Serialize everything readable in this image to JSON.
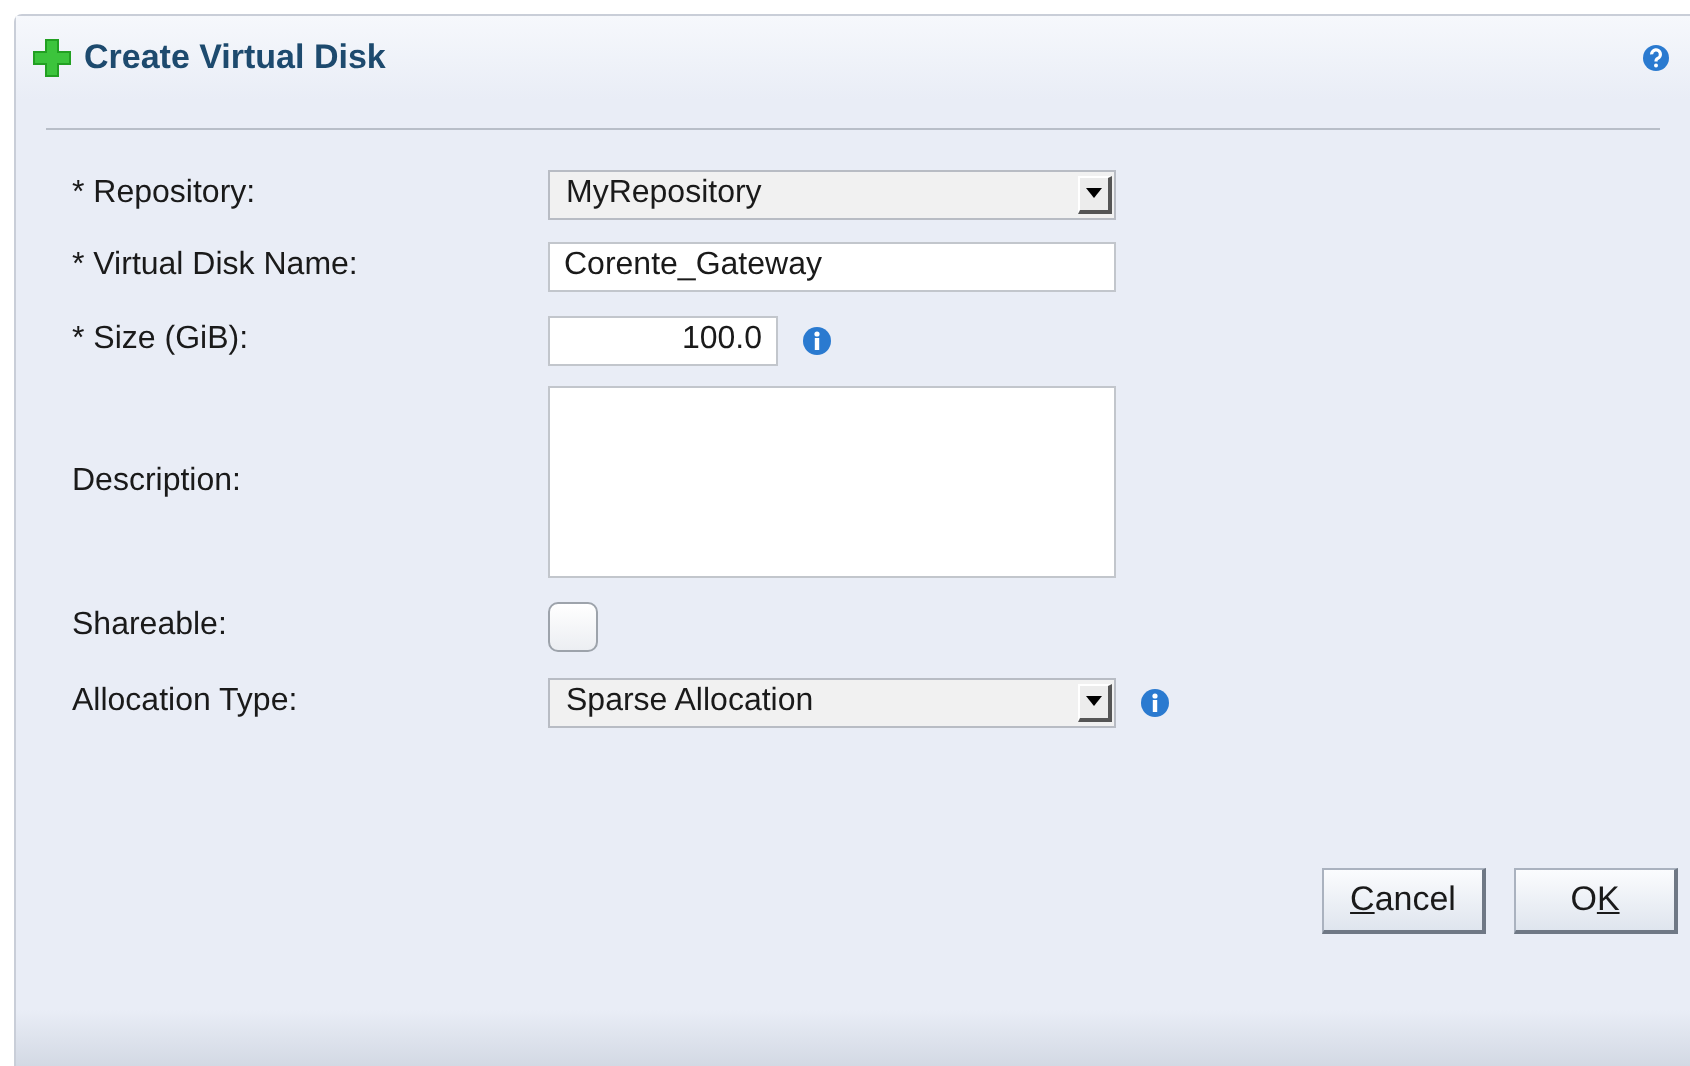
{
  "dialog": {
    "title": "Create Virtual Disk"
  },
  "fields": [
    {
      "kind": "select",
      "label": "* Repository:",
      "value": "MyRepository"
    },
    {
      "kind": "text",
      "label": "* Virtual Disk Name:",
      "value": "Corente_Gateway"
    },
    {
      "kind": "number",
      "label": "* Size (GiB):",
      "value": "100.0",
      "info": true
    },
    {
      "kind": "textarea",
      "label": "Description:"
    },
    {
      "kind": "checkbox",
      "label": "Shareable:",
      "checked": false
    },
    {
      "kind": "select",
      "label": "Allocation Type:",
      "value": "Sparse Allocation",
      "info": true
    }
  ],
  "buttons": [
    {
      "mnemonic": "C",
      "after": "ancel"
    },
    {
      "before": "O",
      "mnemonic": "K"
    }
  ]
}
